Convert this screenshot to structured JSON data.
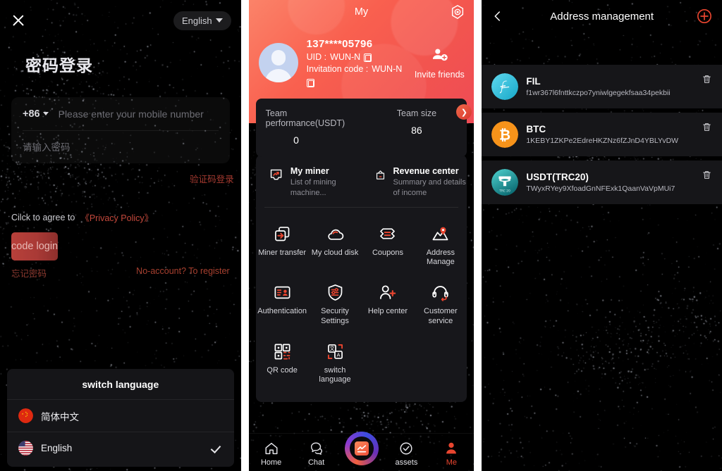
{
  "login": {
    "close_icon": "close-icon",
    "language_selector": {
      "label": "English",
      "icon": "chevron-down-icon"
    },
    "title": "密码登录",
    "country_code": "+86",
    "phone_placeholder": "Please enter your mobile number",
    "password_placeholder": "请输入密码",
    "sms_login_link": "验证码登录",
    "agree_text": "Cilck to agree to",
    "privacy_policy": "《Privacy Policy》",
    "submit_label": "code login",
    "forgot_password": "忘记密码",
    "register_link": "No-account? To register",
    "language_sheet": {
      "title": "switch language",
      "items": [
        {
          "label": "简体中文",
          "flag": "cn-flag-icon",
          "selected": false
        },
        {
          "label": "English",
          "flag": "us-flag-icon",
          "selected": true
        }
      ],
      "check_icon": "check-icon"
    }
  },
  "my": {
    "header_title": "My",
    "settings_icon": "gear-icon",
    "avatar_icon": "avatar",
    "phone": "137****05796",
    "uid_label": "UID :",
    "uid_value": "WUN-N",
    "invitation_label": "Invitation code :",
    "invitation_value": "WUN-N",
    "copy_icon": "copy-icon",
    "invite": {
      "label": "Invite friends",
      "icon": "invite-friends-icon"
    },
    "team": {
      "performance_label": "Team performance(USDT)",
      "performance_value": "0",
      "size_label": "Team size",
      "size_value": "86",
      "arrow_icon": "chevron-right-icon"
    },
    "feature_rows": [
      {
        "title": "My miner",
        "subtitle": "List of mining machine...",
        "icon": "miner-icon"
      },
      {
        "title": "Revenue center",
        "subtitle": "Summary and details of income",
        "icon": "revenue-icon"
      }
    ],
    "grid_items": [
      {
        "label": "Miner transfer",
        "icon": "miner-transfer-icon"
      },
      {
        "label": "My cloud disk",
        "icon": "cloud-disk-icon"
      },
      {
        "label": "Coupons",
        "icon": "coupons-icon"
      },
      {
        "label": "Address Manage",
        "icon": "address-pin-icon"
      },
      {
        "label": "Authentication",
        "icon": "authentication-icon"
      },
      {
        "label": "Security Settings",
        "icon": "shield-settings-icon"
      },
      {
        "label": "Help center",
        "icon": "help-center-icon"
      },
      {
        "label": "Customer service",
        "icon": "headset-icon"
      },
      {
        "label": "QR code",
        "icon": "qr-code-icon"
      },
      {
        "label": "switch language",
        "icon": "translate-icon"
      }
    ],
    "bottom_nav": [
      {
        "label": "Home",
        "icon": "home-icon",
        "active": false
      },
      {
        "label": "Chat",
        "icon": "chat-icon",
        "active": false
      },
      {
        "label": "",
        "icon": "trade-orb-icon",
        "active": false
      },
      {
        "label": "assets",
        "icon": "assets-check-icon",
        "active": false
      },
      {
        "label": "Me",
        "icon": "person-icon",
        "active": true
      }
    ]
  },
  "address": {
    "back_icon": "back-chevron-icon",
    "title": "Address management",
    "add_icon": "plus-circle-icon",
    "delete_icon": "trash-icon",
    "rows": [
      {
        "coin": "FIL",
        "address": "f1wr367l6fnttkczpo7yniwlgegekfsaa34pekbii",
        "icon": "fil-coin-icon",
        "color": "#3fc9e0"
      },
      {
        "coin": "BTC",
        "address": "1KEBY1ZKPe2EdreHKZNz6fZJnD4YBLYvDW",
        "icon": "btc-coin-icon",
        "color": "#f7931a"
      },
      {
        "coin": "USDT(TRC20)",
        "address": "TWyxRYey9XfoadGnNFExk1QaanVaVpMUi7",
        "icon": "usdt-coin-icon",
        "color": "#26a17b"
      }
    ]
  },
  "colors": {
    "accent_red": "#e8452f",
    "header_gradient_start": "#fb8369",
    "header_gradient_end": "#ef4b55",
    "panel_bg": "#17171b",
    "page_bg": "#000000"
  }
}
